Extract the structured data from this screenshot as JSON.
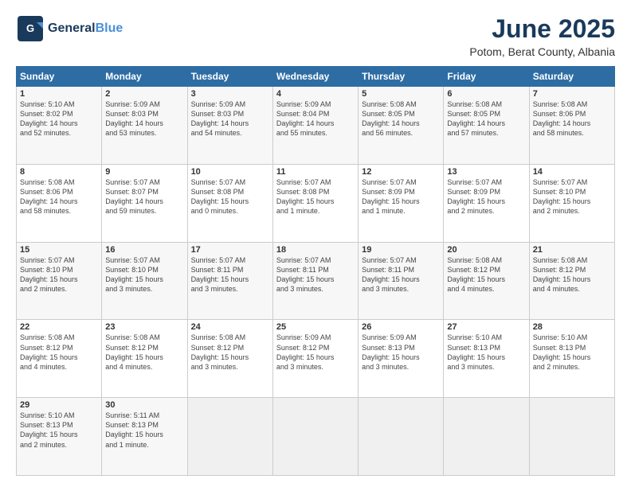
{
  "header": {
    "logo_line1": "General",
    "logo_line2": "Blue",
    "title": "June 2025",
    "subtitle": "Potom, Berat County, Albania"
  },
  "weekdays": [
    "Sunday",
    "Monday",
    "Tuesday",
    "Wednesday",
    "Thursday",
    "Friday",
    "Saturday"
  ],
  "weeks": [
    [
      {
        "day": "1",
        "lines": [
          "Sunrise: 5:10 AM",
          "Sunset: 8:02 PM",
          "Daylight: 14 hours",
          "and 52 minutes."
        ]
      },
      {
        "day": "2",
        "lines": [
          "Sunrise: 5:09 AM",
          "Sunset: 8:03 PM",
          "Daylight: 14 hours",
          "and 53 minutes."
        ]
      },
      {
        "day": "3",
        "lines": [
          "Sunrise: 5:09 AM",
          "Sunset: 8:03 PM",
          "Daylight: 14 hours",
          "and 54 minutes."
        ]
      },
      {
        "day": "4",
        "lines": [
          "Sunrise: 5:09 AM",
          "Sunset: 8:04 PM",
          "Daylight: 14 hours",
          "and 55 minutes."
        ]
      },
      {
        "day": "5",
        "lines": [
          "Sunrise: 5:08 AM",
          "Sunset: 8:05 PM",
          "Daylight: 14 hours",
          "and 56 minutes."
        ]
      },
      {
        "day": "6",
        "lines": [
          "Sunrise: 5:08 AM",
          "Sunset: 8:05 PM",
          "Daylight: 14 hours",
          "and 57 minutes."
        ]
      },
      {
        "day": "7",
        "lines": [
          "Sunrise: 5:08 AM",
          "Sunset: 8:06 PM",
          "Daylight: 14 hours",
          "and 58 minutes."
        ]
      }
    ],
    [
      {
        "day": "8",
        "lines": [
          "Sunrise: 5:08 AM",
          "Sunset: 8:06 PM",
          "Daylight: 14 hours",
          "and 58 minutes."
        ]
      },
      {
        "day": "9",
        "lines": [
          "Sunrise: 5:07 AM",
          "Sunset: 8:07 PM",
          "Daylight: 14 hours",
          "and 59 minutes."
        ]
      },
      {
        "day": "10",
        "lines": [
          "Sunrise: 5:07 AM",
          "Sunset: 8:08 PM",
          "Daylight: 15 hours",
          "and 0 minutes."
        ]
      },
      {
        "day": "11",
        "lines": [
          "Sunrise: 5:07 AM",
          "Sunset: 8:08 PM",
          "Daylight: 15 hours",
          "and 1 minute."
        ]
      },
      {
        "day": "12",
        "lines": [
          "Sunrise: 5:07 AM",
          "Sunset: 8:09 PM",
          "Daylight: 15 hours",
          "and 1 minute."
        ]
      },
      {
        "day": "13",
        "lines": [
          "Sunrise: 5:07 AM",
          "Sunset: 8:09 PM",
          "Daylight: 15 hours",
          "and 2 minutes."
        ]
      },
      {
        "day": "14",
        "lines": [
          "Sunrise: 5:07 AM",
          "Sunset: 8:10 PM",
          "Daylight: 15 hours",
          "and 2 minutes."
        ]
      }
    ],
    [
      {
        "day": "15",
        "lines": [
          "Sunrise: 5:07 AM",
          "Sunset: 8:10 PM",
          "Daylight: 15 hours",
          "and 2 minutes."
        ]
      },
      {
        "day": "16",
        "lines": [
          "Sunrise: 5:07 AM",
          "Sunset: 8:10 PM",
          "Daylight: 15 hours",
          "and 3 minutes."
        ]
      },
      {
        "day": "17",
        "lines": [
          "Sunrise: 5:07 AM",
          "Sunset: 8:11 PM",
          "Daylight: 15 hours",
          "and 3 minutes."
        ]
      },
      {
        "day": "18",
        "lines": [
          "Sunrise: 5:07 AM",
          "Sunset: 8:11 PM",
          "Daylight: 15 hours",
          "and 3 minutes."
        ]
      },
      {
        "day": "19",
        "lines": [
          "Sunrise: 5:07 AM",
          "Sunset: 8:11 PM",
          "Daylight: 15 hours",
          "and 3 minutes."
        ]
      },
      {
        "day": "20",
        "lines": [
          "Sunrise: 5:08 AM",
          "Sunset: 8:12 PM",
          "Daylight: 15 hours",
          "and 4 minutes."
        ]
      },
      {
        "day": "21",
        "lines": [
          "Sunrise: 5:08 AM",
          "Sunset: 8:12 PM",
          "Daylight: 15 hours",
          "and 4 minutes."
        ]
      }
    ],
    [
      {
        "day": "22",
        "lines": [
          "Sunrise: 5:08 AM",
          "Sunset: 8:12 PM",
          "Daylight: 15 hours",
          "and 4 minutes."
        ]
      },
      {
        "day": "23",
        "lines": [
          "Sunrise: 5:08 AM",
          "Sunset: 8:12 PM",
          "Daylight: 15 hours",
          "and 4 minutes."
        ]
      },
      {
        "day": "24",
        "lines": [
          "Sunrise: 5:08 AM",
          "Sunset: 8:12 PM",
          "Daylight: 15 hours",
          "and 3 minutes."
        ]
      },
      {
        "day": "25",
        "lines": [
          "Sunrise: 5:09 AM",
          "Sunset: 8:12 PM",
          "Daylight: 15 hours",
          "and 3 minutes."
        ]
      },
      {
        "day": "26",
        "lines": [
          "Sunrise: 5:09 AM",
          "Sunset: 8:13 PM",
          "Daylight: 15 hours",
          "and 3 minutes."
        ]
      },
      {
        "day": "27",
        "lines": [
          "Sunrise: 5:10 AM",
          "Sunset: 8:13 PM",
          "Daylight: 15 hours",
          "and 3 minutes."
        ]
      },
      {
        "day": "28",
        "lines": [
          "Sunrise: 5:10 AM",
          "Sunset: 8:13 PM",
          "Daylight: 15 hours",
          "and 2 minutes."
        ]
      }
    ],
    [
      {
        "day": "29",
        "lines": [
          "Sunrise: 5:10 AM",
          "Sunset: 8:13 PM",
          "Daylight: 15 hours",
          "and 2 minutes."
        ]
      },
      {
        "day": "30",
        "lines": [
          "Sunrise: 5:11 AM",
          "Sunset: 8:13 PM",
          "Daylight: 15 hours",
          "and 1 minute."
        ]
      },
      {
        "day": "",
        "lines": []
      },
      {
        "day": "",
        "lines": []
      },
      {
        "day": "",
        "lines": []
      },
      {
        "day": "",
        "lines": []
      },
      {
        "day": "",
        "lines": []
      }
    ]
  ]
}
